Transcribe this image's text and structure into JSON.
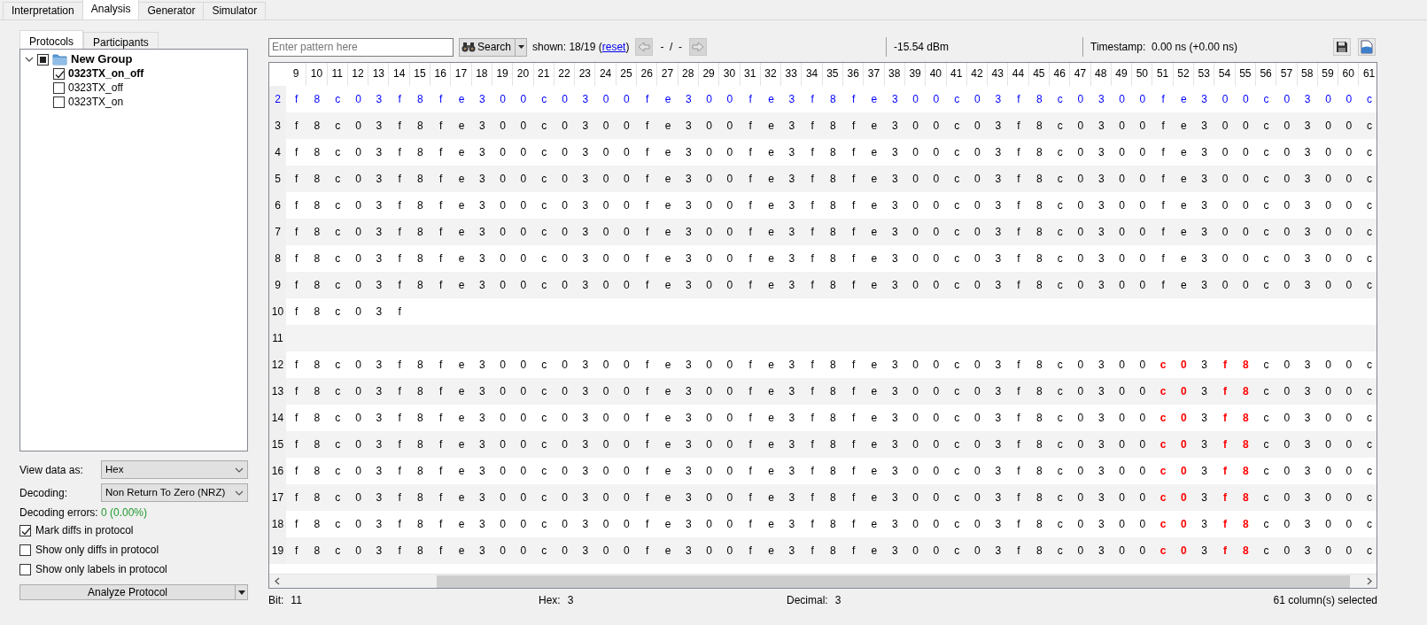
{
  "main_tabs": [
    {
      "label": "Interpretation",
      "selected": false
    },
    {
      "label": "Analysis",
      "selected": true
    },
    {
      "label": "Generator",
      "selected": false
    },
    {
      "label": "Simulator",
      "selected": false
    }
  ],
  "side_tabs": [
    {
      "label": "Protocols",
      "selected": true
    },
    {
      "label": "Participants",
      "selected": false
    }
  ],
  "tree": [
    {
      "label": "New Group",
      "kind": "group",
      "expanded": true,
      "checked": false,
      "partial": true,
      "active": true,
      "children": [
        {
          "label": "0323TX_on_off",
          "kind": "protocol",
          "checked": true,
          "active": true
        },
        {
          "label": "0323TX_off",
          "kind": "protocol",
          "checked": false,
          "active": false
        },
        {
          "label": "0323TX_on",
          "kind": "protocol",
          "checked": false,
          "active": false
        }
      ]
    }
  ],
  "view_data_as": {
    "label": "View data as:",
    "value": "Hex"
  },
  "decoding": {
    "label": "Decoding:",
    "value": "Non Return To Zero (NRZ)"
  },
  "decoding_errors": {
    "label": "Decoding errors:",
    "value": "0 (0.00%)"
  },
  "options": [
    {
      "label": "Mark diffs in protocol",
      "checked": true
    },
    {
      "label": "Show only diffs in protocol",
      "checked": false
    },
    {
      "label": "Show only labels in protocol",
      "checked": false
    }
  ],
  "analyze_button": "Analyze Protocol",
  "search": {
    "placeholder": "Enter pattern here",
    "button": "Search",
    "shown": "shown: 18/19 (",
    "reset_link": "reset",
    "shown_end": ")",
    "position": "-  /  -"
  },
  "signal_strength": "-15.54 dBm",
  "timestamp": "Timestamp:  0.00 ns (+0.00 ns)",
  "table": {
    "columns": [
      "9",
      "10",
      "11",
      "12",
      "13",
      "14",
      "15",
      "16",
      "17",
      "18",
      "19",
      "20",
      "21",
      "22",
      "23",
      "24",
      "25",
      "26",
      "27",
      "28",
      "29",
      "30",
      "31",
      "32",
      "33",
      "34",
      "35",
      "36",
      "37",
      "38",
      "39",
      "40",
      "41",
      "42",
      "43",
      "44",
      "45",
      "46",
      "47",
      "48",
      "49",
      "50",
      "51",
      "52",
      "53",
      "54",
      "55",
      "56",
      "57",
      "58",
      "59",
      "60",
      "61"
    ],
    "rows": [
      {
        "label": "2",
        "reference": true,
        "cells": [
          "f",
          "8",
          "c",
          "0",
          "3",
          "f",
          "8",
          "f",
          "e",
          "3",
          "0",
          "0",
          "c",
          "0",
          "3",
          "0",
          "0",
          "f",
          "e",
          "3",
          "0",
          "0",
          "f",
          "e",
          "3",
          "f",
          "8",
          "f",
          "e",
          "3",
          "0",
          "0",
          "c",
          "0",
          "3",
          "f",
          "8",
          "c",
          "0",
          "3",
          "0",
          "0",
          "f",
          "e",
          "3",
          "0",
          "0",
          "c",
          "0",
          "3",
          "0",
          "0",
          "c"
        ]
      },
      {
        "label": "3",
        "reference": false,
        "cells": [
          "f",
          "8",
          "c",
          "0",
          "3",
          "f",
          "8",
          "f",
          "e",
          "3",
          "0",
          "0",
          "c",
          "0",
          "3",
          "0",
          "0",
          "f",
          "e",
          "3",
          "0",
          "0",
          "f",
          "e",
          "3",
          "f",
          "8",
          "f",
          "e",
          "3",
          "0",
          "0",
          "c",
          "0",
          "3",
          "f",
          "8",
          "c",
          "0",
          "3",
          "0",
          "0",
          "f",
          "e",
          "3",
          "0",
          "0",
          "c",
          "0",
          "3",
          "0",
          "0",
          "c"
        ]
      },
      {
        "label": "4",
        "reference": false,
        "cells": [
          "f",
          "8",
          "c",
          "0",
          "3",
          "f",
          "8",
          "f",
          "e",
          "3",
          "0",
          "0",
          "c",
          "0",
          "3",
          "0",
          "0",
          "f",
          "e",
          "3",
          "0",
          "0",
          "f",
          "e",
          "3",
          "f",
          "8",
          "f",
          "e",
          "3",
          "0",
          "0",
          "c",
          "0",
          "3",
          "f",
          "8",
          "c",
          "0",
          "3",
          "0",
          "0",
          "f",
          "e",
          "3",
          "0",
          "0",
          "c",
          "0",
          "3",
          "0",
          "0",
          "c"
        ]
      },
      {
        "label": "5",
        "reference": false,
        "cells": [
          "f",
          "8",
          "c",
          "0",
          "3",
          "f",
          "8",
          "f",
          "e",
          "3",
          "0",
          "0",
          "c",
          "0",
          "3",
          "0",
          "0",
          "f",
          "e",
          "3",
          "0",
          "0",
          "f",
          "e",
          "3",
          "f",
          "8",
          "f",
          "e",
          "3",
          "0",
          "0",
          "c",
          "0",
          "3",
          "f",
          "8",
          "c",
          "0",
          "3",
          "0",
          "0",
          "f",
          "e",
          "3",
          "0",
          "0",
          "c",
          "0",
          "3",
          "0",
          "0",
          "c"
        ]
      },
      {
        "label": "6",
        "reference": false,
        "cells": [
          "f",
          "8",
          "c",
          "0",
          "3",
          "f",
          "8",
          "f",
          "e",
          "3",
          "0",
          "0",
          "c",
          "0",
          "3",
          "0",
          "0",
          "f",
          "e",
          "3",
          "0",
          "0",
          "f",
          "e",
          "3",
          "f",
          "8",
          "f",
          "e",
          "3",
          "0",
          "0",
          "c",
          "0",
          "3",
          "f",
          "8",
          "c",
          "0",
          "3",
          "0",
          "0",
          "f",
          "e",
          "3",
          "0",
          "0",
          "c",
          "0",
          "3",
          "0",
          "0",
          "c"
        ]
      },
      {
        "label": "7",
        "reference": false,
        "cells": [
          "f",
          "8",
          "c",
          "0",
          "3",
          "f",
          "8",
          "f",
          "e",
          "3",
          "0",
          "0",
          "c",
          "0",
          "3",
          "0",
          "0",
          "f",
          "e",
          "3",
          "0",
          "0",
          "f",
          "e",
          "3",
          "f",
          "8",
          "f",
          "e",
          "3",
          "0",
          "0",
          "c",
          "0",
          "3",
          "f",
          "8",
          "c",
          "0",
          "3",
          "0",
          "0",
          "f",
          "e",
          "3",
          "0",
          "0",
          "c",
          "0",
          "3",
          "0",
          "0",
          "c"
        ]
      },
      {
        "label": "8",
        "reference": false,
        "cells": [
          "f",
          "8",
          "c",
          "0",
          "3",
          "f",
          "8",
          "f",
          "e",
          "3",
          "0",
          "0",
          "c",
          "0",
          "3",
          "0",
          "0",
          "f",
          "e",
          "3",
          "0",
          "0",
          "f",
          "e",
          "3",
          "f",
          "8",
          "f",
          "e",
          "3",
          "0",
          "0",
          "c",
          "0",
          "3",
          "f",
          "8",
          "c",
          "0",
          "3",
          "0",
          "0",
          "f",
          "e",
          "3",
          "0",
          "0",
          "c",
          "0",
          "3",
          "0",
          "0",
          "c"
        ]
      },
      {
        "label": "9",
        "reference": false,
        "cells": [
          "f",
          "8",
          "c",
          "0",
          "3",
          "f",
          "8",
          "f",
          "e",
          "3",
          "0",
          "0",
          "c",
          "0",
          "3",
          "0",
          "0",
          "f",
          "e",
          "3",
          "0",
          "0",
          "f",
          "e",
          "3",
          "f",
          "8",
          "f",
          "e",
          "3",
          "0",
          "0",
          "c",
          "0",
          "3",
          "f",
          "8",
          "c",
          "0",
          "3",
          "0",
          "0",
          "f",
          "e",
          "3",
          "0",
          "0",
          "c",
          "0",
          "3",
          "0",
          "0",
          "c"
        ]
      },
      {
        "label": "10",
        "reference": false,
        "cells": [
          "f",
          "8",
          "c",
          "0",
          "3",
          "f"
        ]
      },
      {
        "label": "11",
        "reference": false
      },
      {
        "label": "12",
        "reference": false,
        "cells": [
          "f",
          "8",
          "c",
          "0",
          "3",
          "f",
          "8",
          "f",
          "e",
          "3",
          "0",
          "0",
          "c",
          "0",
          "3",
          "0",
          "0",
          "f",
          "e",
          "3",
          "0",
          "0",
          "f",
          "e",
          "3",
          "f",
          "8",
          "f",
          "e",
          "3",
          "0",
          "0",
          "c",
          "0",
          "3",
          "f",
          "8",
          "c",
          "0",
          "3",
          "0",
          "0",
          {
            "text": "c",
            "diff": true
          },
          {
            "text": "0",
            "diff": true
          },
          "3",
          {
            "text": "f",
            "diff": true
          },
          {
            "text": "8",
            "diff": true
          },
          "c",
          "0",
          "3",
          "0",
          "0",
          "c"
        ]
      },
      {
        "label": "13",
        "reference": false,
        "cells": [
          "f",
          "8",
          "c",
          "0",
          "3",
          "f",
          "8",
          "f",
          "e",
          "3",
          "0",
          "0",
          "c",
          "0",
          "3",
          "0",
          "0",
          "f",
          "e",
          "3",
          "0",
          "0",
          "f",
          "e",
          "3",
          "f",
          "8",
          "f",
          "e",
          "3",
          "0",
          "0",
          "c",
          "0",
          "3",
          "f",
          "8",
          "c",
          "0",
          "3",
          "0",
          "0",
          {
            "text": "c",
            "diff": true
          },
          {
            "text": "0",
            "diff": true
          },
          "3",
          {
            "text": "f",
            "diff": true
          },
          {
            "text": "8",
            "diff": true
          },
          "c",
          "0",
          "3",
          "0",
          "0",
          "c"
        ]
      },
      {
        "label": "14",
        "reference": false,
        "cells": [
          "f",
          "8",
          "c",
          "0",
          "3",
          "f",
          "8",
          "f",
          "e",
          "3",
          "0",
          "0",
          "c",
          "0",
          "3",
          "0",
          "0",
          "f",
          "e",
          "3",
          "0",
          "0",
          "f",
          "e",
          "3",
          "f",
          "8",
          "f",
          "e",
          "3",
          "0",
          "0",
          "c",
          "0",
          "3",
          "f",
          "8",
          "c",
          "0",
          "3",
          "0",
          "0",
          {
            "text": "c",
            "diff": true
          },
          {
            "text": "0",
            "diff": true
          },
          "3",
          {
            "text": "f",
            "diff": true
          },
          {
            "text": "8",
            "diff": true
          },
          "c",
          "0",
          "3",
          "0",
          "0",
          "c"
        ]
      },
      {
        "label": "15",
        "reference": false,
        "cells": [
          "f",
          "8",
          "c",
          "0",
          "3",
          "f",
          "8",
          "f",
          "e",
          "3",
          "0",
          "0",
          "c",
          "0",
          "3",
          "0",
          "0",
          "f",
          "e",
          "3",
          "0",
          "0",
          "f",
          "e",
          "3",
          "f",
          "8",
          "f",
          "e",
          "3",
          "0",
          "0",
          "c",
          "0",
          "3",
          "f",
          "8",
          "c",
          "0",
          "3",
          "0",
          "0",
          {
            "text": "c",
            "diff": true
          },
          {
            "text": "0",
            "diff": true
          },
          "3",
          {
            "text": "f",
            "diff": true
          },
          {
            "text": "8",
            "diff": true
          },
          "c",
          "0",
          "3",
          "0",
          "0",
          "c"
        ]
      },
      {
        "label": "16",
        "reference": false,
        "cells": [
          "f",
          "8",
          "c",
          "0",
          "3",
          "f",
          "8",
          "f",
          "e",
          "3",
          "0",
          "0",
          "c",
          "0",
          "3",
          "0",
          "0",
          "f",
          "e",
          "3",
          "0",
          "0",
          "f",
          "e",
          "3",
          "f",
          "8",
          "f",
          "e",
          "3",
          "0",
          "0",
          "c",
          "0",
          "3",
          "f",
          "8",
          "c",
          "0",
          "3",
          "0",
          "0",
          {
            "text": "c",
            "diff": true
          },
          {
            "text": "0",
            "diff": true
          },
          "3",
          {
            "text": "f",
            "diff": true
          },
          {
            "text": "8",
            "diff": true
          },
          "c",
          "0",
          "3",
          "0",
          "0",
          "c"
        ]
      },
      {
        "label": "17",
        "reference": false,
        "cells": [
          "f",
          "8",
          "c",
          "0",
          "3",
          "f",
          "8",
          "f",
          "e",
          "3",
          "0",
          "0",
          "c",
          "0",
          "3",
          "0",
          "0",
          "f",
          "e",
          "3",
          "0",
          "0",
          "f",
          "e",
          "3",
          "f",
          "8",
          "f",
          "e",
          "3",
          "0",
          "0",
          "c",
          "0",
          "3",
          "f",
          "8",
          "c",
          "0",
          "3",
          "0",
          "0",
          {
            "text": "c",
            "diff": true
          },
          {
            "text": "0",
            "diff": true
          },
          "3",
          {
            "text": "f",
            "diff": true
          },
          {
            "text": "8",
            "diff": true
          },
          "c",
          "0",
          "3",
          "0",
          "0",
          "c"
        ]
      },
      {
        "label": "18",
        "reference": false,
        "cells": [
          "f",
          "8",
          "c",
          "0",
          "3",
          "f",
          "8",
          "f",
          "e",
          "3",
          "0",
          "0",
          "c",
          "0",
          "3",
          "0",
          "0",
          "f",
          "e",
          "3",
          "0",
          "0",
          "f",
          "e",
          "3",
          "f",
          "8",
          "f",
          "e",
          "3",
          "0",
          "0",
          "c",
          "0",
          "3",
          "f",
          "8",
          "c",
          "0",
          "3",
          "0",
          "0",
          {
            "text": "c",
            "diff": true
          },
          {
            "text": "0",
            "diff": true
          },
          "3",
          {
            "text": "f",
            "diff": true
          },
          {
            "text": "8",
            "diff": true
          },
          "c",
          "0",
          "3",
          "0",
          "0",
          "c"
        ]
      },
      {
        "label": "19",
        "reference": false,
        "cells": [
          "f",
          "8",
          "c",
          "0",
          "3",
          "f",
          "8",
          "f",
          "e",
          "3",
          "0",
          "0",
          "c",
          "0",
          "3",
          "0",
          "0",
          "f",
          "e",
          "3",
          "0",
          "0",
          "f",
          "e",
          "3",
          "f",
          "8",
          "f",
          "e",
          "3",
          "0",
          "0",
          "c",
          "0",
          "3",
          "f",
          "8",
          "c",
          "0",
          "3",
          "0",
          "0",
          {
            "text": "c",
            "diff": true
          },
          {
            "text": "0",
            "diff": true
          },
          "3",
          {
            "text": "f",
            "diff": true
          },
          {
            "text": "8",
            "diff": true
          },
          "c",
          "0",
          "3",
          "0",
          "0",
          "c"
        ]
      }
    ]
  },
  "status_bar": {
    "bit_label": "Bit:",
    "bit": "11",
    "hex_label": "Hex:",
    "hex": "3",
    "decimal_label": "Decimal:",
    "decimal": "3",
    "selection": "61 column(s) selected"
  }
}
